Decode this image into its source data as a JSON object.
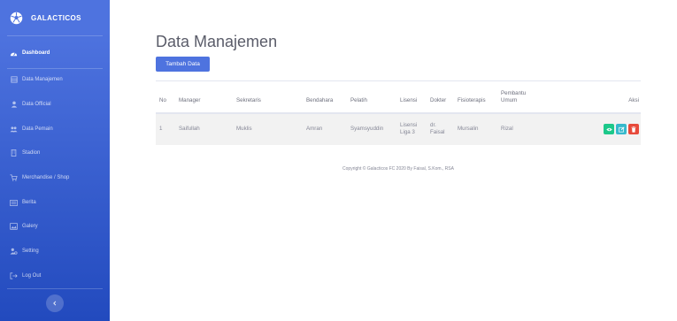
{
  "brand": {
    "name": "GALACTICOS",
    "icon": "soccer-ball-icon"
  },
  "sidebar": {
    "items": [
      {
        "label": "Dashboard",
        "icon": "tachometer-icon",
        "active": true
      },
      {
        "label": "Data Manajemen",
        "icon": "table-icon",
        "active": false
      },
      {
        "label": "Data Official",
        "icon": "user-icon",
        "active": false
      },
      {
        "label": "Data Pemain",
        "icon": "users-icon",
        "active": false
      },
      {
        "label": "Stadion",
        "icon": "building-icon",
        "active": false
      },
      {
        "label": "Merchandise / Shop",
        "icon": "cart-icon",
        "active": false
      },
      {
        "label": "Berita",
        "icon": "newspaper-icon",
        "active": false
      },
      {
        "label": "Galery",
        "icon": "image-icon",
        "active": false
      },
      {
        "label": "Setting",
        "icon": "user-cog-icon",
        "active": false
      },
      {
        "label": "Log Out",
        "icon": "logout-icon",
        "active": false
      }
    ],
    "toggle_icon": "chevron-left-icon"
  },
  "main": {
    "title": "Data Manajemen",
    "add_button": "Tambah Data",
    "table": {
      "headers": {
        "no": "No",
        "manager": "Manager",
        "sekretaris": "Sekretaris",
        "bendahara": "Bendahara",
        "pelatih": "Pelatih",
        "lisensi": "Lisensi",
        "dokter": "Dokter",
        "fisioterapis": "Fisioterapis",
        "pembantu": "Pembantu Umum",
        "aksi": "Aksi"
      },
      "rows": [
        {
          "no": "1",
          "manager": "Saifullah",
          "sekretaris": "Muklis",
          "bendahara": "Amran",
          "pelatih": "Syamsyuddin",
          "lisensi": "Lisensi Liga 3",
          "dokter": "dr. Faisal",
          "fisioterapis": "Mursalin",
          "pembantu": "Rizal"
        }
      ]
    },
    "footer": "Copyright © Galacticos FC 2020 By Faisal, S.Kom., RSA"
  },
  "colors": {
    "sidebar_top": "#4e73df",
    "sidebar_bottom": "#224abe",
    "primary": "#4e73df",
    "success": "#1cc88a",
    "info": "#36b9cc",
    "danger": "#e74a3b"
  }
}
